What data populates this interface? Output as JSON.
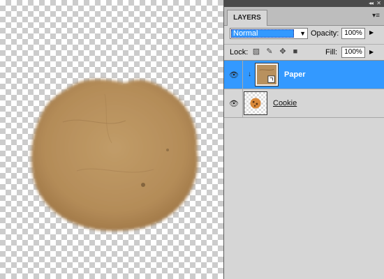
{
  "canvas": {
    "artwork_icon": "rounded-paper-texture"
  },
  "panel": {
    "tab_label": "LAYERS",
    "collapse_icon": "double-chevron-right-icon",
    "close_icon": "close-icon",
    "menu_icon": "panel-menu-icon",
    "blend_mode": {
      "value": "Normal"
    },
    "opacity": {
      "label": "Opacity:",
      "value": "100%"
    },
    "lock": {
      "label": "Lock:",
      "icons": [
        "lock-transparent-pixels-icon",
        "lock-image-pixels-icon",
        "lock-position-icon",
        "lock-all-icon"
      ]
    },
    "fill": {
      "label": "Fill:",
      "value": "100%"
    }
  },
  "layers": [
    {
      "name": "Paper",
      "visible": true,
      "selected": true,
      "clipped": true,
      "thumbnail": "paper-texture"
    },
    {
      "name": "Cookie",
      "visible": true,
      "selected": false,
      "clipped": false,
      "thumbnail": "cookie"
    }
  ],
  "colors": {
    "selection": "#3399ff",
    "panel_bg": "#d6d6d6",
    "panel_header": "#4b4b4b",
    "paper": "#b8915e"
  }
}
